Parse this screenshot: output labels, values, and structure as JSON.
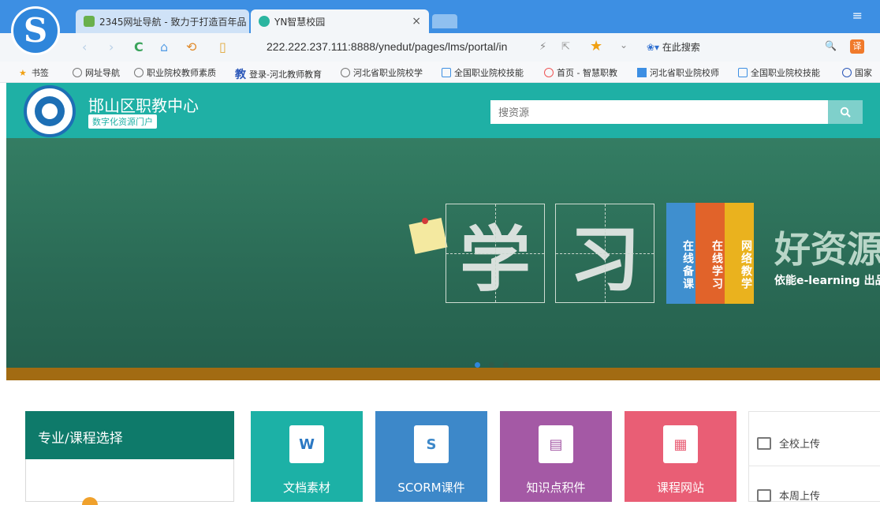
{
  "browser": {
    "logo_letter": "S",
    "tabs": [
      {
        "label": "2345网址导航 - 致力于打造百年品"
      },
      {
        "label": "YN智慧校园",
        "close": "×"
      }
    ],
    "menu_icon": "≡",
    "nav": {
      "back": "‹",
      "forward": "›",
      "refresh": "C",
      "home": "⌂",
      "undo": "⟲",
      "reader": "▯"
    },
    "url": "222.222.237.111:8888/ynedut/pages/lms/portal/in",
    "url_actions": {
      "bolt": "⚡",
      "share": "⇱",
      "star": "★",
      "dropdown": "⌄"
    },
    "search_engine_label": "在此搜索",
    "search_icon": "🔍",
    "translate_label": "译",
    "bookmarks": [
      {
        "label": "书签",
        "icon": "star-icon"
      },
      {
        "label": "网址导航",
        "icon": "globe-icon"
      },
      {
        "label": "职业院校教师素质",
        "icon": "globe-icon"
      },
      {
        "label": "登录-河北教师教育",
        "icon": "jiao-icon",
        "prefix": "教"
      },
      {
        "label": "河北省职业院校学",
        "icon": "globe-icon"
      },
      {
        "label": "全国职业院校技能",
        "icon": "graduation-icon"
      },
      {
        "label": "首页 - 智慧职教",
        "icon": "flower-icon"
      },
      {
        "label": "河北省职业院校师",
        "icon": "windows-icon"
      },
      {
        "label": "全国职业院校技能",
        "icon": "graduation-icon"
      },
      {
        "label": "国家",
        "icon": "cap-icon"
      }
    ]
  },
  "site": {
    "title": "邯山区职教中心",
    "subtitle": "数字化资源门户",
    "search_placeholder": "搜资源"
  },
  "banner": {
    "char1": "学",
    "char2": "习",
    "bars": [
      "在线备课",
      "在线学习",
      "网络教学"
    ],
    "big_text": "好资源",
    "sub_text": "依能e-learning  出品"
  },
  "major_panel": {
    "title": "专业/课程选择"
  },
  "tiles": [
    {
      "label": "文档素材",
      "icon_text": "W"
    },
    {
      "label": "SCORM课件",
      "icon_text": "S"
    },
    {
      "label": "知识点积件",
      "icon_text": "▤"
    },
    {
      "label": "课程网站",
      "icon_text": "▦"
    }
  ],
  "uploads": [
    {
      "label": "全校上传"
    },
    {
      "label": "本周上传"
    }
  ],
  "colors": {
    "browser_blue": "#3d8fe3",
    "header_teal": "#1fb0a5",
    "chalkboard_green": "#2c6e58",
    "tile_teal": "#1cb1a6",
    "tile_blue": "#3d88c9",
    "tile_purple": "#a459a5",
    "tile_pink": "#e95e75"
  }
}
